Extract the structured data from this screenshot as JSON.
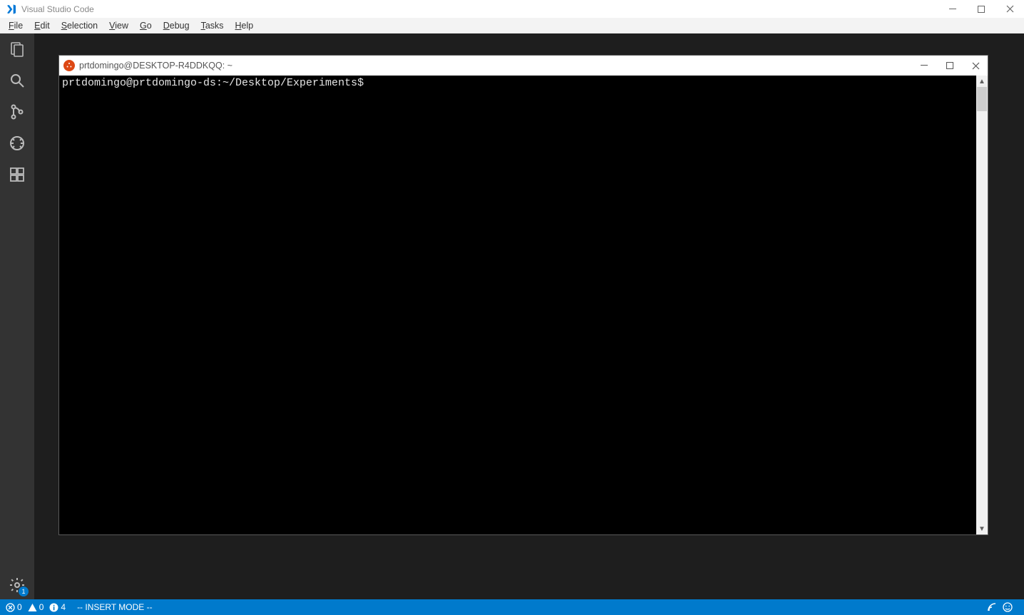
{
  "titlebar": {
    "title": "Visual Studio Code"
  },
  "menu": {
    "items": [
      {
        "mn": "F",
        "rest": "ile"
      },
      {
        "mn": "E",
        "rest": "dit"
      },
      {
        "mn": "S",
        "rest": "election"
      },
      {
        "mn": "V",
        "rest": "iew"
      },
      {
        "mn": "G",
        "rest": "o"
      },
      {
        "mn": "D",
        "rest": "ebug"
      },
      {
        "mn": "T",
        "rest": "asks"
      },
      {
        "mn": "H",
        "rest": "elp"
      }
    ]
  },
  "activitybar": {
    "gear_badge": "1"
  },
  "terminal": {
    "title": "prtdomingo@DESKTOP-R4DDKQQ: ~",
    "prompt": "prtdomingo@prtdomingo-ds:~/Desktop/Experiments$"
  },
  "statusbar": {
    "errors": "0",
    "warnings": "0",
    "info": "4",
    "mode": "-- INSERT MODE --"
  }
}
